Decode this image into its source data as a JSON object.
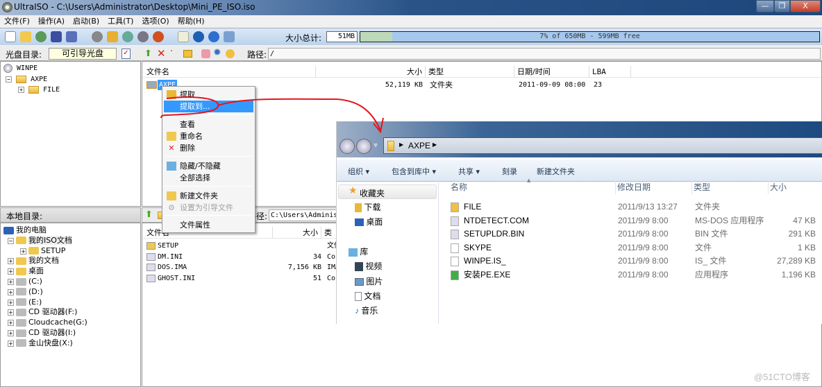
{
  "window": {
    "title": "UltraISO - C:\\Users\\Administrator\\Desktop\\Mini_PE_ISO.iso",
    "min": "—",
    "restore": "❐",
    "close": "X"
  },
  "menu": [
    "文件(F)",
    "操作(A)",
    "启动(B)",
    "工具(T)",
    "选项(O)",
    "帮助(H)"
  ],
  "toolbar": {
    "size_label": "大小总计:",
    "size_value": "51MB",
    "capacity_text": "7% of 650MB - 599MB free",
    "used_percent": 7
  },
  "iso_bar": {
    "label": "光盘目录:",
    "boot_type": "可引导光盘",
    "path_label": "路径:",
    "path": "/"
  },
  "iso_tree": [
    {
      "label": "WINPE",
      "level": 0
    },
    {
      "label": "AXPE",
      "level": 1,
      "expander": "−"
    },
    {
      "label": "FILE",
      "level": 2,
      "expander": "+"
    }
  ],
  "iso_list": {
    "columns": [
      "文件名",
      "大小",
      "类型",
      "日期/时间",
      "LBA"
    ],
    "rows": [
      {
        "name": "AXPE",
        "size": "52,119 KB",
        "type": "文件夹",
        "date": "2011-09-09 08:00",
        "lba": "23"
      }
    ]
  },
  "context_menu": [
    {
      "label": "提取",
      "icon": "extract-icon"
    },
    {
      "label": "提取到...",
      "icon": "",
      "highlighted": true
    },
    {
      "label": "查看",
      "icon": ""
    },
    {
      "label": "重命名",
      "icon": "rename-icon"
    },
    {
      "label": "删除",
      "icon": "delete-icon"
    },
    {
      "label": "隐藏/不隐藏",
      "icon": "hide-icon"
    },
    {
      "label": "全部选择",
      "icon": ""
    },
    {
      "label": "新建文件夹",
      "icon": "new-folder-icon"
    },
    {
      "label": "设置为引导文件",
      "icon": "gear-icon",
      "disabled": true
    },
    {
      "label": "文件属性",
      "icon": ""
    }
  ],
  "local_bar": {
    "label": "本地目录:",
    "path_label": "路径:",
    "path": "C:\\Users\\Administr"
  },
  "local_tree": [
    {
      "label": "我的电脑",
      "level": 0
    },
    {
      "label": "我的ISO文档",
      "level": 1,
      "expander": "−"
    },
    {
      "label": "SETUP",
      "level": 2,
      "expander": "+"
    },
    {
      "label": "我的文档",
      "level": 1,
      "expander": "+"
    },
    {
      "label": "桌面",
      "level": 1,
      "expander": "+"
    },
    {
      "label": "(C:)",
      "level": 1,
      "expander": "+"
    },
    {
      "label": "(D:)",
      "level": 1,
      "expander": "+"
    },
    {
      "label": "(E:)",
      "level": 1,
      "expander": "+"
    },
    {
      "label": "CD 驱动器(F:)",
      "level": 1,
      "expander": "+"
    },
    {
      "label": "Cloudcache(G:)",
      "level": 1,
      "expander": "+"
    },
    {
      "label": "CD 驱动器(I:)",
      "level": 1,
      "expander": "+"
    },
    {
      "label": "金山快盘(X:)",
      "level": 1,
      "expander": "+"
    }
  ],
  "local_list": {
    "columns": [
      "文件名",
      "大小",
      "类"
    ],
    "rows": [
      {
        "name": "SETUP",
        "size": "",
        "type": "文件"
      },
      {
        "name": "DM.INI",
        "size": "34",
        "type": "Cor"
      },
      {
        "name": "DOS.IMA",
        "size": "7,156 KB",
        "type": "IMA"
      },
      {
        "name": "GHOST.INI",
        "size": "51",
        "type": "Cor"
      }
    ]
  },
  "explorer": {
    "breadcrumb": "AXPE",
    "commands": [
      "组织 ▾",
      "包含到库中 ▾",
      "共享 ▾",
      "刻录",
      "新建文件夹"
    ],
    "nav": {
      "favorites": "收藏夹",
      "fav_items": [
        "下载",
        "桌面"
      ],
      "library": "库",
      "lib_items": [
        "视频",
        "图片",
        "文档",
        "音乐"
      ]
    },
    "columns": [
      "名称",
      "修改日期",
      "类型",
      "大小"
    ],
    "rows": [
      {
        "name": "FILE",
        "date": "2011/9/13 13:27",
        "type": "文件夹",
        "size": ""
      },
      {
        "name": "NTDETECT.COM",
        "date": "2011/9/9 8:00",
        "type": "MS-DOS 应用程序",
        "size": "47 KB"
      },
      {
        "name": "SETUPLDR.BIN",
        "date": "2011/9/9 8:00",
        "type": "BIN 文件",
        "size": "291 KB"
      },
      {
        "name": "SKYPE",
        "date": "2011/9/9 8:00",
        "type": "文件",
        "size": "1 KB"
      },
      {
        "name": "WINPE.IS_",
        "date": "2011/9/9 8:00",
        "type": "IS_ 文件",
        "size": "27,289 KB"
      },
      {
        "name": "安装PE.EXE",
        "date": "2011/9/9 8:00",
        "type": "应用程序",
        "size": "1,196 KB"
      }
    ]
  },
  "watermark": "@51CTO博客",
  "colors": {
    "annotation": "#e8141c",
    "highlight": "#3399ff",
    "title_bar": "#1d477c"
  }
}
